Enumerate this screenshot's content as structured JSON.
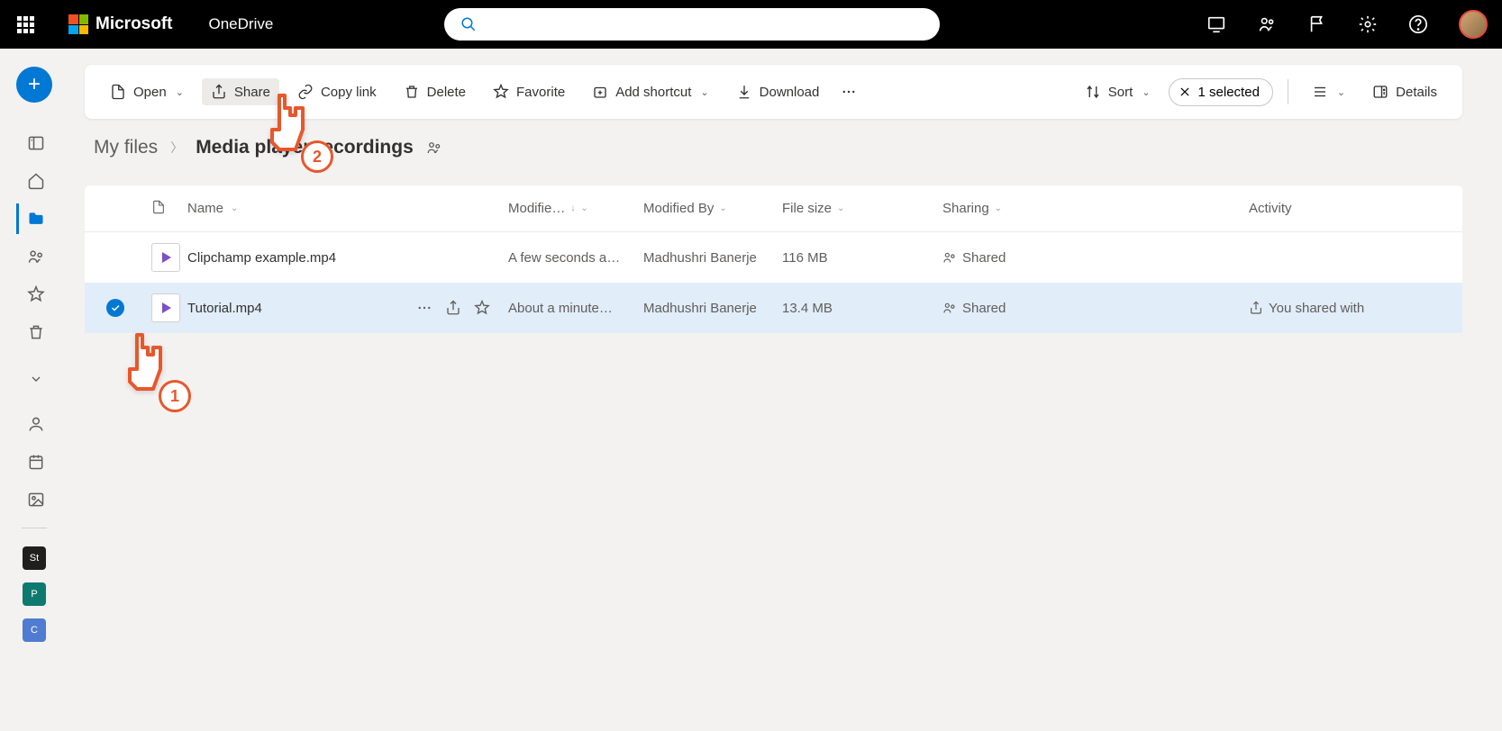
{
  "header": {
    "brand": "Microsoft",
    "app": "OneDrive",
    "search_placeholder": ""
  },
  "toolbar": {
    "open": "Open",
    "share": "Share",
    "copylink": "Copy link",
    "delete": "Delete",
    "favorite": "Favorite",
    "addshortcut": "Add shortcut",
    "download": "Download",
    "sort": "Sort",
    "selected": "1 selected",
    "details": "Details"
  },
  "breadcrumb": {
    "root": "My files",
    "current": "Media player recordings"
  },
  "columns": {
    "name": "Name",
    "modified": "Modifie…",
    "modifiedby": "Modified By",
    "size": "File size",
    "sharing": "Sharing",
    "activity": "Activity"
  },
  "files": [
    {
      "name": "Clipchamp example.mp4",
      "modified": "A few seconds a…",
      "modifiedby": "Madhushri Banerje",
      "size": "116 MB",
      "sharing": "Shared",
      "selected": false,
      "activity": ""
    },
    {
      "name": "Tutorial.mp4",
      "modified": "About a minute…",
      "modifiedby": "Madhushri Banerje",
      "size": "13.4 MB",
      "sharing": "Shared",
      "selected": true,
      "activity": "You shared with"
    }
  ],
  "annotations": {
    "step1": "1",
    "step2": "2"
  }
}
